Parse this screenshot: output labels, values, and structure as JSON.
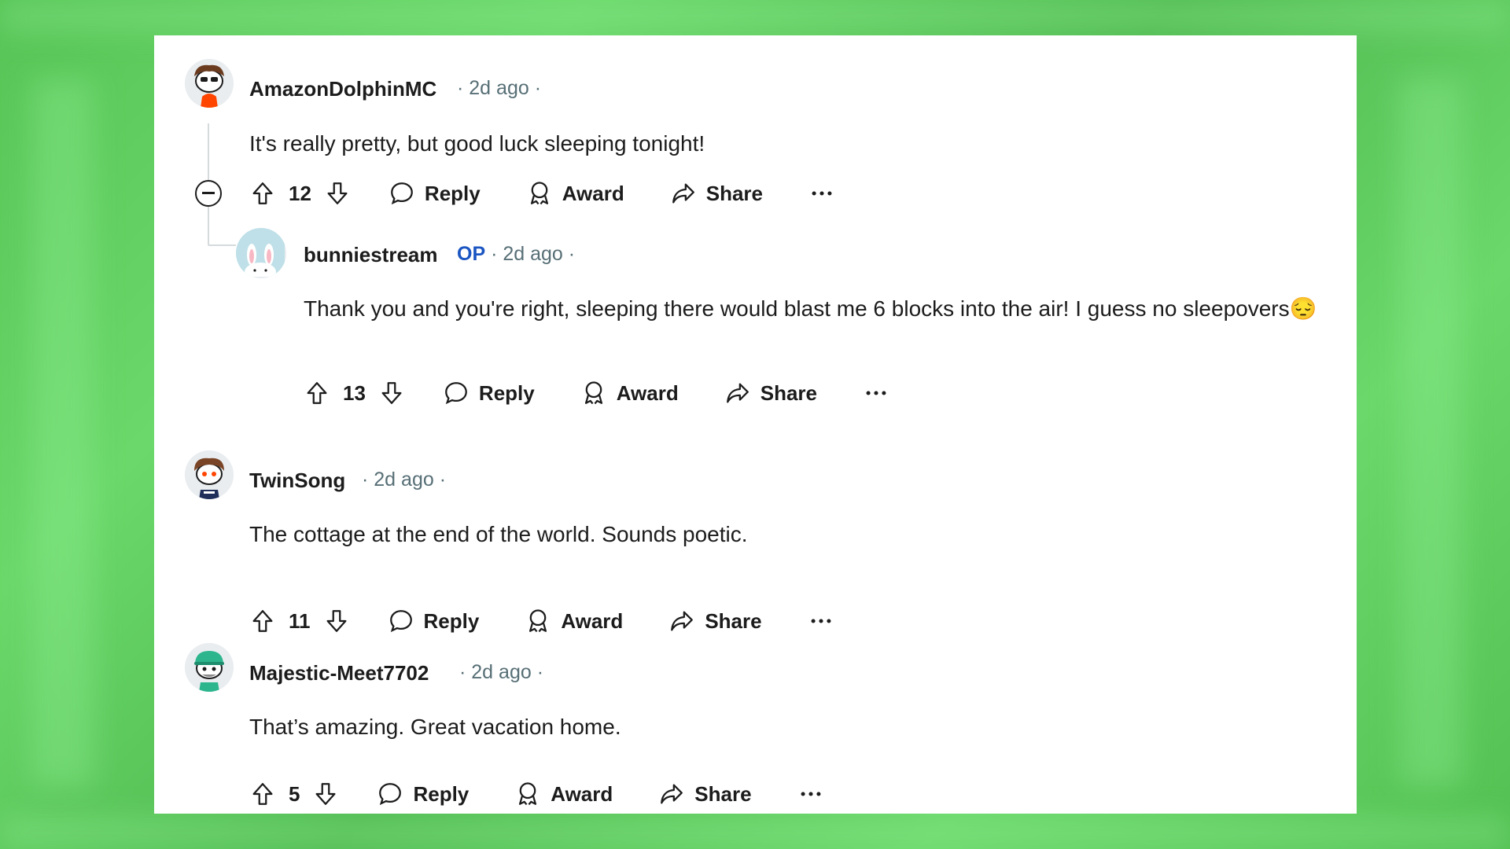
{
  "colors": {
    "background": "#5fcf5f",
    "card": "#ffffff",
    "text": "#1c1c1c",
    "meta": "#576f76",
    "op": "#1a55c2"
  },
  "comments": [
    {
      "username": "AmazonDolphinMC",
      "time": "2d ago",
      "text": "It's really pretty, but good luck sleeping tonight!",
      "votes": "12",
      "reply": "Reply",
      "award": "Award",
      "share": "Share",
      "avatar_icon": "snoo-sunglasses-avatar"
    },
    {
      "username": "bunniestream",
      "op": "OP",
      "time": "2d ago",
      "text": "Thank you and you're right, sleeping there would blast me 6 blocks into the air! I guess no sleepovers😔",
      "votes": "13",
      "reply": "Reply",
      "award": "Award",
      "share": "Share",
      "avatar_icon": "bunny-avatar"
    },
    {
      "username": "TwinSong",
      "time": "2d ago",
      "text": "The cottage at the end of the world. Sounds poetic.",
      "votes": "11",
      "reply": "Reply",
      "award": "Award",
      "share": "Share",
      "avatar_icon": "snoo-hair-avatar"
    },
    {
      "username": "Majestic-Meet7702",
      "time": "2d ago",
      "text": "That’s amazing. Great vacation home.",
      "votes": "5",
      "reply": "Reply",
      "award": "Award",
      "share": "Share",
      "avatar_icon": "snoo-cap-avatar"
    }
  ]
}
